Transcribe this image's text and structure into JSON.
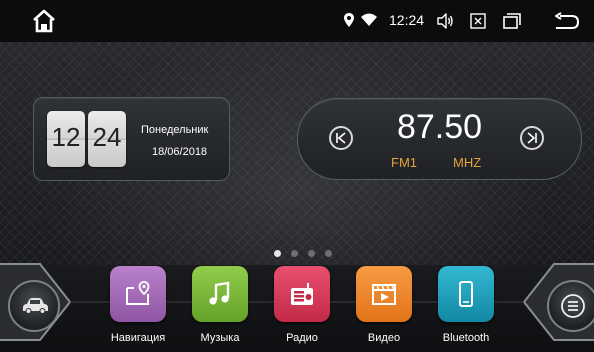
{
  "status_bar": {
    "time": "12:24",
    "icons": [
      "home-icon",
      "location-pin-icon",
      "wifi-icon",
      "volume-icon",
      "close-box-icon",
      "recent-apps-icon",
      "back-icon"
    ]
  },
  "clock_widget": {
    "hour": "12",
    "minute": "24",
    "day": "Понедельник",
    "date": "18/06/2018"
  },
  "radio_widget": {
    "frequency": "87.50",
    "band": "FM1",
    "unit": "MHZ"
  },
  "page_indicator": {
    "pages": 4,
    "active_index": 0
  },
  "dock": {
    "left_button_icon": "car-icon",
    "right_button_icon": "menu-icon",
    "apps": [
      {
        "label": "Навигация",
        "icon": "map-icon",
        "color": "#a36ab6"
      },
      {
        "label": "Музыка",
        "icon": "music-note-icon",
        "color": "#7dbb3b"
      },
      {
        "label": "Радио",
        "icon": "radio-icon",
        "color": "#d9395c"
      },
      {
        "label": "Видео",
        "icon": "video-icon",
        "color": "#ef8628"
      },
      {
        "label": "Bluetooth",
        "icon": "phone-icon",
        "color": "#1fa3be"
      }
    ]
  },
  "colors": {
    "accent_orange": "#e8a23a",
    "status_bar_bg": "#0c0c0d"
  }
}
